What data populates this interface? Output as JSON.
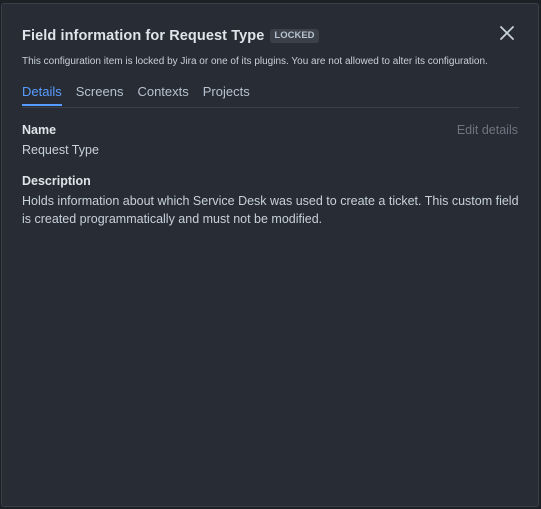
{
  "dialog": {
    "title": "Field information for Request Type",
    "badge": "LOCKED",
    "subtitle": "This configuration item is locked by Jira or one of its plugins. You are not allowed to alter its configuration.",
    "close_icon": "close-icon"
  },
  "tabs": [
    {
      "label": "Details",
      "active": true
    },
    {
      "label": "Screens",
      "active": false
    },
    {
      "label": "Contexts",
      "active": false
    },
    {
      "label": "Projects",
      "active": false
    }
  ],
  "details": {
    "edit_label": "Edit details",
    "name_label": "Name",
    "name_value": "Request Type",
    "description_label": "Description",
    "description_value": "Holds information about which Service Desk was used to create a ticket. This custom field is created programmatically and must not be modified."
  },
  "colors": {
    "background": "#282c34",
    "accent": "#579dff",
    "text": "#c7d1db"
  }
}
